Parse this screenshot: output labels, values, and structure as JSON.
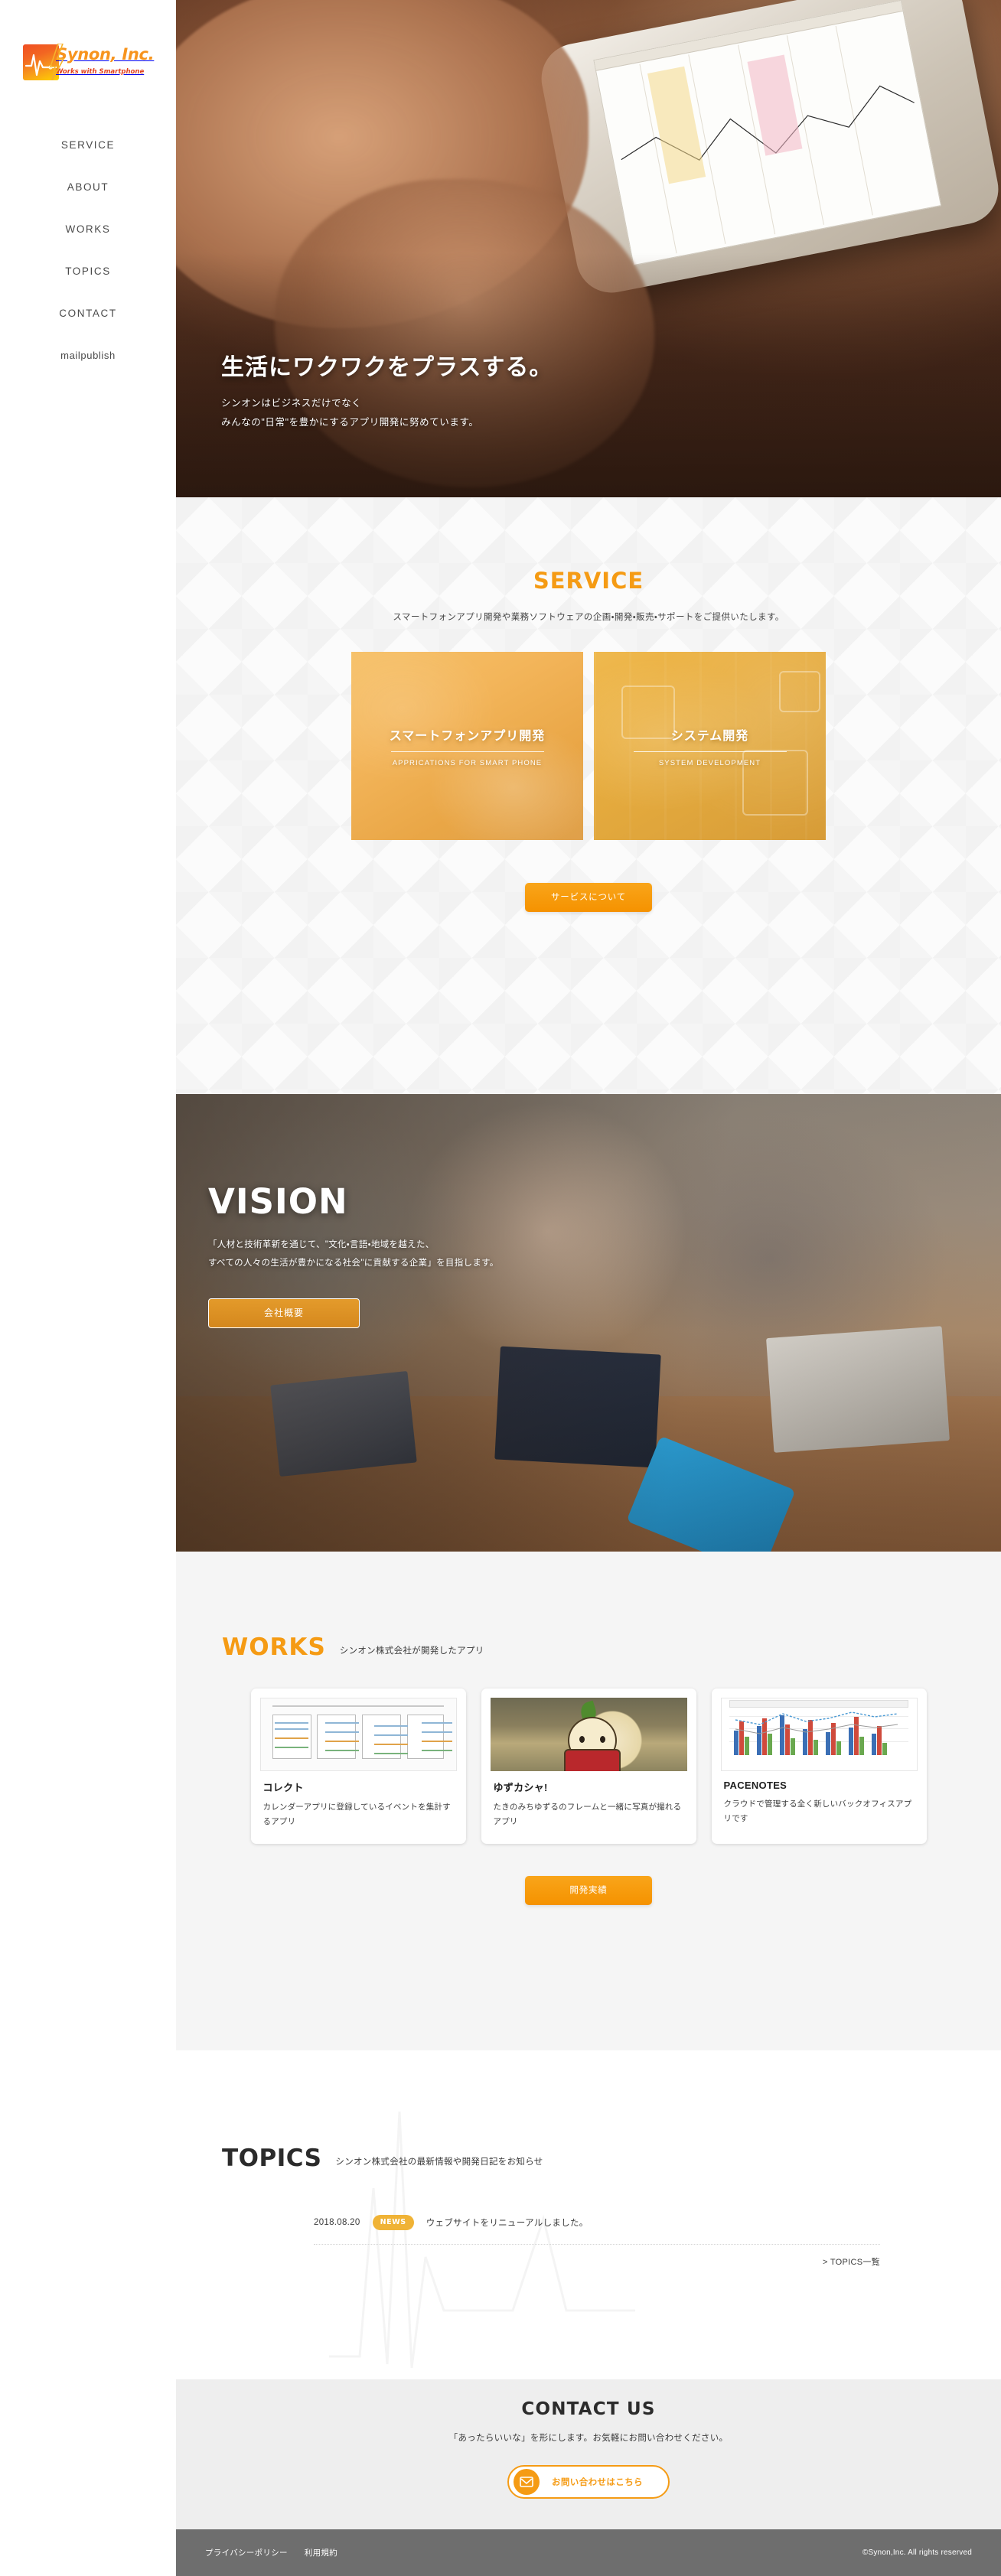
{
  "brand": {
    "name": "Synon, Inc.",
    "tagline": "Works with Smartphone",
    "accent": "#f59b14",
    "logo_icon": "heartbeat-pulse-icon"
  },
  "nav": {
    "items": [
      {
        "label": "SERVICE"
      },
      {
        "label": "ABOUT"
      },
      {
        "label": "WORKS"
      },
      {
        "label": "TOPICS"
      },
      {
        "label": "CONTACT"
      },
      {
        "label": "mailpublish"
      }
    ]
  },
  "hero": {
    "title": "生活にワクワクをプラスする。",
    "lead_line1": "シンオンはビジネスだけでなく",
    "lead_line2": "みんなの\"日常\"を豊かにするアプリ開発に努めています。"
  },
  "service": {
    "title": "SERVICE",
    "lead": "スマートフォンアプリ開発や業務ソフトウェアの企画・開発・販売・サポートをご提供いたします。",
    "cards": [
      {
        "title": "スマートフォンアプリ開発",
        "subtitle": "APPRICATIONS FOR SMART PHONE"
      },
      {
        "title": "システム開発",
        "subtitle": "SYSTEM DEVELOPMENT"
      }
    ],
    "button": "サービスについて"
  },
  "vision": {
    "title": "VISION",
    "lead_line1": "「人材と技術革新を通じて、\"文化・言語・地域を越えた、",
    "lead_line2": "すべての人々の生活が豊かになる社会\"に貢献する企業」を目指します。",
    "button": "会社概要"
  },
  "works": {
    "title": "WORKS",
    "subtitle": "シンオン株式会社が開発したアプリ",
    "cards": [
      {
        "title": "コレクト",
        "description": "カレンダーアプリに登録しているイベントを集計するアプリ",
        "thumb": "calendar-grid-thumbnail"
      },
      {
        "title": "ゆずカシャ!",
        "description": "たきのみちゆずるのフレームと一緒に写真が撮れるアプリ",
        "thumb": "character-photo-thumbnail"
      },
      {
        "title": "PACENOTES",
        "description": "クラウドで管理する全く新しいバックオフィスアプリです",
        "thumb": "bar-chart-thumbnail"
      }
    ],
    "button": "開発実績"
  },
  "topics": {
    "title": "TOPICS",
    "subtitle": "シンオン株式会社の最新情報や開発日記をお知らせ",
    "items": [
      {
        "date": "2018.08.20",
        "badge": "NEWS",
        "text": "ウェブサイトをリニューアルしました。"
      }
    ],
    "more_label": "> TOPICS一覧"
  },
  "contact": {
    "title": "CONTACT US",
    "lead": "「あったらいいな」を形にします。お気軽にお問い合わせください。",
    "button": "お問い合わせはこちら",
    "button_icon": "mail-envelope-icon"
  },
  "footer": {
    "links": [
      {
        "label": "プライバシーポリシー"
      },
      {
        "label": "利用規約"
      }
    ],
    "copyright": "©Synon,Inc. All rights reserved"
  }
}
